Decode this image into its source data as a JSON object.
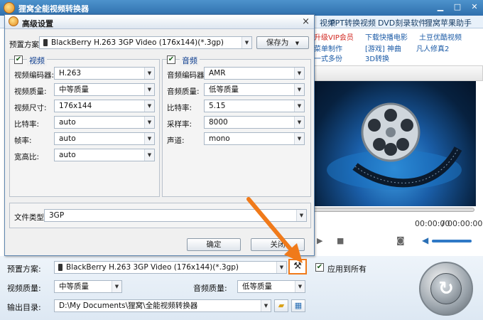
{
  "app": {
    "title": "狸窝全能视频转换器",
    "menu": [
      "视频",
      "PPT转换视频",
      "DVD刻录软件",
      "狸窝苹果助手"
    ],
    "promo": {
      "vip": "升级VIP会员",
      "links": [
        "下载快播电影",
        "土豆优酷视频",
        "[游戏] 神曲",
        "凡人修真2",
        "3D转换"
      ],
      "left_items": [
        "菜单制作",
        "一式多份"
      ]
    },
    "player": {
      "time_current": "00:00:00",
      "time_total": "00:00:00",
      "progress": 0
    }
  },
  "dialog": {
    "title": "高级设置",
    "close_glyph": "×",
    "preset_label": "预置方案:",
    "preset_value": "BlackBerry H.263 3GP Video (176x144)(*.3gp)",
    "save_as": "保存为",
    "video": {
      "header": "视频",
      "enabled": true,
      "fields": [
        {
          "label": "视频编码器:",
          "value": "H.263"
        },
        {
          "label": "视频质量:",
          "value": "中等质量"
        },
        {
          "label": "视频尺寸:",
          "value": "176x144"
        },
        {
          "label": "比特率:",
          "value": "auto"
        },
        {
          "label": "帧率:",
          "value": "auto"
        },
        {
          "label": "宽高比:",
          "value": "auto"
        }
      ]
    },
    "audio": {
      "header": "音频",
      "enabled": true,
      "fields": [
        {
          "label": "音频编码器:",
          "value": "AMR"
        },
        {
          "label": "音频质量:",
          "value": "低等质量"
        },
        {
          "label": "比特率:",
          "value": "5.15"
        },
        {
          "label": "采样率:",
          "value": "8000"
        },
        {
          "label": "声道:",
          "value": "mono"
        }
      ]
    },
    "file_type_label": "文件类型:",
    "file_type_value": "3GP",
    "ok": "确定",
    "cancel": "关闭"
  },
  "bottom": {
    "preset_label": "预置方案:",
    "preset_value": "BlackBerry H.263 3GP Video (176x144)(*.3gp)",
    "apply_all": "应用到所有",
    "apply_all_checked": true,
    "video_quality_label": "视频质量:",
    "video_quality_value": "中等质量",
    "audio_quality_label": "音频质量:",
    "audio_quality_value": "低等质量",
    "output_label": "输出目录:",
    "output_value": "D:\\My Documents\\狸窝\\全能视频转换器"
  },
  "colors": {
    "accent_arrow": "#f07a1a",
    "title_bar": "#3a7cbd"
  }
}
